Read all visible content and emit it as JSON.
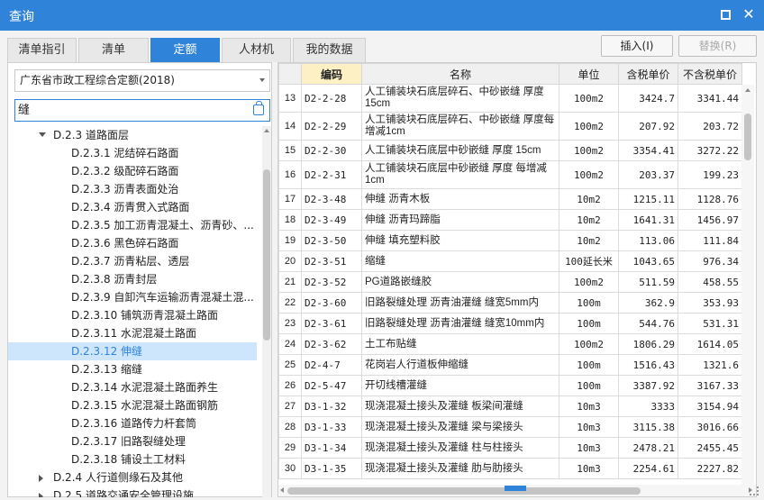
{
  "window": {
    "title": "查询"
  },
  "tabs": [
    {
      "label": "清单指引",
      "active": false
    },
    {
      "label": "清单",
      "active": false
    },
    {
      "label": "定额",
      "active": true
    },
    {
      "label": "人材机",
      "active": false
    },
    {
      "label": "我的数据",
      "active": false
    }
  ],
  "toolbar": {
    "insert_label": "插入(I)",
    "replace_label": "替换(R)"
  },
  "left": {
    "library_select": "广东省市政工程综合定额(2018)",
    "search_value": "缝",
    "tree": [
      {
        "label": "D.2.3 道路面层",
        "level": 1,
        "expand": "down"
      },
      {
        "label": "D.2.3.1 泥结碎石路面",
        "level": 2
      },
      {
        "label": "D.2.3.2 级配碎石路面",
        "level": 2
      },
      {
        "label": "D.2.3.3 沥青表面处治",
        "level": 2
      },
      {
        "label": "D.2.3.4 沥青贯入式路面",
        "level": 2
      },
      {
        "label": "D.2.3.5 加工沥青混凝土、沥青砂、...",
        "level": 2
      },
      {
        "label": "D.2.3.6 黑色碎石路面",
        "level": 2
      },
      {
        "label": "D.2.3.7 沥青粘层、透层",
        "level": 2
      },
      {
        "label": "D.2.3.8 沥青封层",
        "level": 2
      },
      {
        "label": "D.2.3.9 自卸汽车运输沥青混凝土混...",
        "level": 2
      },
      {
        "label": "D.2.3.10 铺筑沥青混凝土路面",
        "level": 2
      },
      {
        "label": "D.2.3.11 水泥混凝土路面",
        "level": 2
      },
      {
        "label": "D.2.3.12 伸缝",
        "level": 2,
        "selected": true
      },
      {
        "label": "D.2.3.13 缩缝",
        "level": 2
      },
      {
        "label": "D.2.3.14 水泥混凝土路面养生",
        "level": 2
      },
      {
        "label": "D.2.3.15 水泥混凝土路面钢筋",
        "level": 2
      },
      {
        "label": "D.2.3.16 道路传力杆套筒",
        "level": 2
      },
      {
        "label": "D.2.3.17 旧路裂缝处理",
        "level": 2
      },
      {
        "label": "D.2.3.18 铺设土工材料",
        "level": 2
      },
      {
        "label": "D.2.4 人行道侧缘石及其他",
        "level": 1,
        "expand": "right"
      },
      {
        "label": "D.2.5 道路交通安全管理设施",
        "level": 1,
        "expand": "right"
      }
    ]
  },
  "grid": {
    "columns": [
      "",
      "编码",
      "名称",
      "单位",
      "含税单价",
      "不含税单价"
    ],
    "rows": [
      {
        "idx": "13",
        "code": "D2-2-28",
        "name": "人工铺装块石底层碎石、中砂嵌缝 厚度15cm",
        "unit": "100m2",
        "price_tax": "3424.7",
        "price_notax": "3341.44"
      },
      {
        "idx": "14",
        "code": "D2-2-29",
        "name": "人工铺装块石底层碎石、中砂嵌缝 厚度每增减1cm",
        "unit": "100m2",
        "price_tax": "207.92",
        "price_notax": "203.72"
      },
      {
        "idx": "15",
        "code": "D2-2-30",
        "name": "人工铺装块石底层中砂嵌缝 厚度 15cm",
        "unit": "100m2",
        "price_tax": "3354.41",
        "price_notax": "3272.22"
      },
      {
        "idx": "16",
        "code": "D2-2-31",
        "name": "人工铺装块石底层中砂嵌缝 厚度 每增减1cm",
        "unit": "100m2",
        "price_tax": "203.37",
        "price_notax": "199.23"
      },
      {
        "idx": "17",
        "code": "D2-3-48",
        "name": "伸缝 沥青木板",
        "unit": "10m2",
        "price_tax": "1215.11",
        "price_notax": "1128.76"
      },
      {
        "idx": "18",
        "code": "D2-3-49",
        "name": "伸缝 沥青玛蹄脂",
        "unit": "10m2",
        "price_tax": "1641.31",
        "price_notax": "1456.97"
      },
      {
        "idx": "19",
        "code": "D2-3-50",
        "name": "伸缝 填充塑料胶",
        "unit": "10m2",
        "price_tax": "113.06",
        "price_notax": "111.84"
      },
      {
        "idx": "20",
        "code": "D2-3-51",
        "name": "缩缝",
        "unit": "100延长米",
        "price_tax": "1043.65",
        "price_notax": "976.34"
      },
      {
        "idx": "21",
        "code": "D2-3-52",
        "name": "PG道路嵌缝胶",
        "unit": "100m2",
        "price_tax": "511.59",
        "price_notax": "458.55"
      },
      {
        "idx": "22",
        "code": "D2-3-60",
        "name": "旧路裂缝处理 沥青油灌缝 缝宽5mm内",
        "unit": "100m",
        "price_tax": "362.9",
        "price_notax": "353.93"
      },
      {
        "idx": "23",
        "code": "D2-3-61",
        "name": "旧路裂缝处理 沥青油灌缝 缝宽10mm内",
        "unit": "100m",
        "price_tax": "544.76",
        "price_notax": "531.31"
      },
      {
        "idx": "24",
        "code": "D2-3-62",
        "name": "土工布贴缝",
        "unit": "100m2",
        "price_tax": "1806.29",
        "price_notax": "1614.05"
      },
      {
        "idx": "25",
        "code": "D2-4-7",
        "name": "花岗岩人行道板伸缩缝",
        "unit": "100m",
        "price_tax": "1516.43",
        "price_notax": "1321.6"
      },
      {
        "idx": "26",
        "code": "D2-5-47",
        "name": "开切线槽灌缝",
        "unit": "100m",
        "price_tax": "3387.92",
        "price_notax": "3167.33"
      },
      {
        "idx": "27",
        "code": "D3-1-32",
        "name": "现浇混凝土接头及灌缝 板梁间灌缝",
        "unit": "10m3",
        "price_tax": "3333",
        "price_notax": "3154.94"
      },
      {
        "idx": "28",
        "code": "D3-1-33",
        "name": "现浇混凝土接头及灌缝 梁与梁接头",
        "unit": "10m3",
        "price_tax": "3115.38",
        "price_notax": "3016.66"
      },
      {
        "idx": "29",
        "code": "D3-1-34",
        "name": "现浇混凝土接头及灌缝 柱与柱接头",
        "unit": "10m3",
        "price_tax": "2478.21",
        "price_notax": "2455.45"
      },
      {
        "idx": "30",
        "code": "D3-1-35",
        "name": "现浇混凝土接头及灌缝 肋与肋接头",
        "unit": "10m3",
        "price_tax": "2254.61",
        "price_notax": "2227.82"
      }
    ]
  }
}
